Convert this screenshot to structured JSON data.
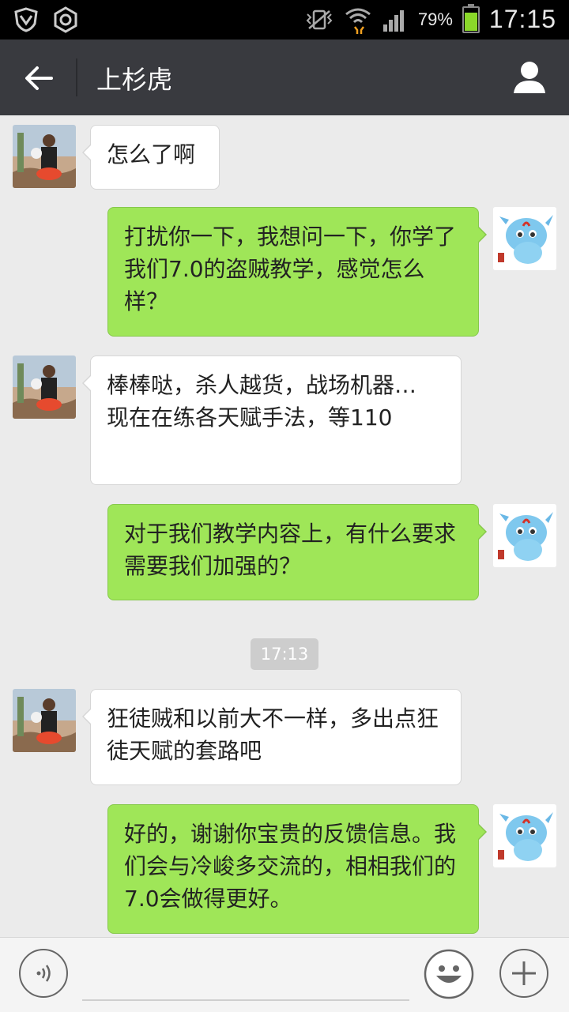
{
  "status_bar": {
    "battery_percent_text": "79%",
    "battery_level": 0.79,
    "time": "17:15",
    "battery_color": "#8bd82a"
  },
  "header": {
    "title": "上杉虎",
    "back_icon": "arrow-left-icon",
    "profile_icon": "person-icon",
    "background": "#393a3f"
  },
  "messages": [
    {
      "side": "in",
      "text": "怎么了啊"
    },
    {
      "side": "out",
      "text": "打扰你一下，我想问一下，你学了我们7.0的盗贼教学，感觉怎么样？"
    },
    {
      "side": "in",
      "text": "棒棒哒，杀人越货，战场机器… 现在在练各天赋手法，等110"
    },
    {
      "side": "out",
      "text": "对于我们教学内容上，有什么要求需要我们加强的？"
    },
    {
      "side": "out",
      "text": "好的，谢谢你宝贵的反馈信息。我们会与冷峻多交流的，相相我们的7.0会做得更好。"
    },
    {
      "side": "in",
      "text": "狂徒贼和以前大不一样，多出点狂徒天赋的套路吧"
    }
  ],
  "timestamp": "17:13",
  "input_bar": {
    "voice_icon": "voice-icon",
    "emoji_icon": "smiley-icon",
    "plus_icon": "plus-icon",
    "text_value": ""
  },
  "colors": {
    "incoming_bubble": "#ffffff",
    "outgoing_bubble": "#9fe658",
    "chat_background": "#ebebeb"
  }
}
